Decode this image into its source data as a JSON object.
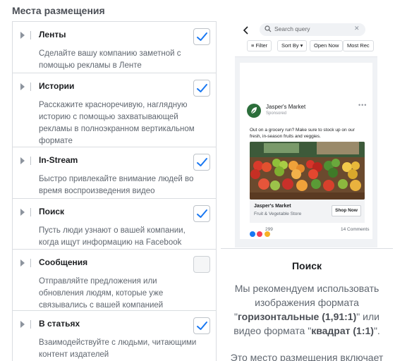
{
  "section_title": "Места размещения",
  "placements": [
    {
      "name": "Ленты",
      "description": "Сделайте вашу компанию заметной с помощью рекламы в Ленте",
      "checked": true
    },
    {
      "name": "Истории",
      "description": "Расскажите красноречивую, наглядную историю с помощью захватывающей рекламы в полноэкранном вертикальном формате",
      "checked": true
    },
    {
      "name": "In-Stream",
      "description": "Быстро привлекайте внимание людей во время воспроизведения видео",
      "checked": true
    },
    {
      "name": "Поиск",
      "description": "Пусть люди узнают о вашей компании, когда ищут информацию на Facebook",
      "checked": true
    },
    {
      "name": "Сообщения",
      "description": "Отправляйте предложения или обновления людям, которые уже связывались с вашей компанией",
      "checked": false
    },
    {
      "name": "В статьях",
      "description": "Взаимодействуйте с людьми, читающими контент издателей",
      "checked": true
    }
  ],
  "preview": {
    "search_placeholder": "Search query",
    "chips": [
      "Filter",
      "Sort By",
      "Open Now",
      "Most Rec"
    ],
    "post": {
      "page_name": "Jasper's Market",
      "sponsored": "Sponsored",
      "text": "Out on a grocery run? Make sure to stock up on our fresh, in-season fruits and veggies.",
      "cta_title": "Jasper's Market",
      "cta_subtitle": "Fruit & Vegetable Store",
      "cta_button": "Shop Now",
      "reactions_count": "299",
      "comments": "14 Comments"
    },
    "title": "Поиск",
    "desc_prefix": "Мы рекомендуем использовать изображения формата \"",
    "format_horizontal": "горизонтальные (1,91:1)",
    "desc_middle": "\" или видео формата \"",
    "format_square": "квадрат (1:1)",
    "desc_suffix": "\".",
    "more_text": "Это место размещения включает"
  },
  "colors": {
    "accent": "#1877f2",
    "border": "#dadde1",
    "muted_text": "#606770"
  }
}
